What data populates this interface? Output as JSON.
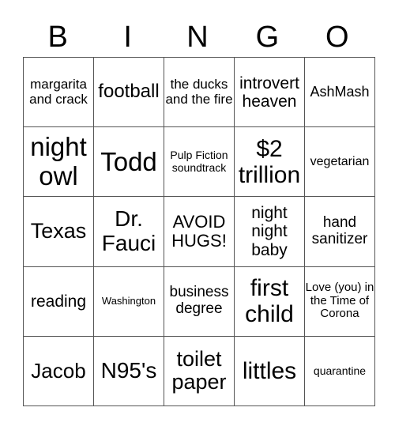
{
  "header": [
    "B",
    "I",
    "N",
    "G",
    "O"
  ],
  "rows": [
    [
      {
        "text": "margarita and crack",
        "size": 17
      },
      {
        "text": "football",
        "size": 24
      },
      {
        "text": "the ducks and the fire",
        "size": 17
      },
      {
        "text": "introvert heaven",
        "size": 21
      },
      {
        "text": "AshMash",
        "size": 18
      }
    ],
    [
      {
        "text": "night owl",
        "size": 33
      },
      {
        "text": "Todd",
        "size": 33
      },
      {
        "text": "Pulp Fiction soundtrack",
        "size": 14
      },
      {
        "text": "$2 trillion",
        "size": 30
      },
      {
        "text": "vegetarian",
        "size": 16
      }
    ],
    [
      {
        "text": "Texas",
        "size": 27
      },
      {
        "text": "Dr. Fauci",
        "size": 28
      },
      {
        "text": "AVOID HUGS!",
        "size": 22
      },
      {
        "text": "night night baby",
        "size": 21
      },
      {
        "text": "hand sanitizer",
        "size": 19
      }
    ],
    [
      {
        "text": "reading",
        "size": 21
      },
      {
        "text": "Washington",
        "size": 13
      },
      {
        "text": "business degree",
        "size": 19
      },
      {
        "text": "first child",
        "size": 30
      },
      {
        "text": "Love (you) in the Time of Corona",
        "size": 15
      }
    ],
    [
      {
        "text": "Jacob",
        "size": 26
      },
      {
        "text": "N95's",
        "size": 28
      },
      {
        "text": "toilet paper",
        "size": 27
      },
      {
        "text": "littles",
        "size": 30
      },
      {
        "text": "quarantine",
        "size": 14
      }
    ]
  ]
}
